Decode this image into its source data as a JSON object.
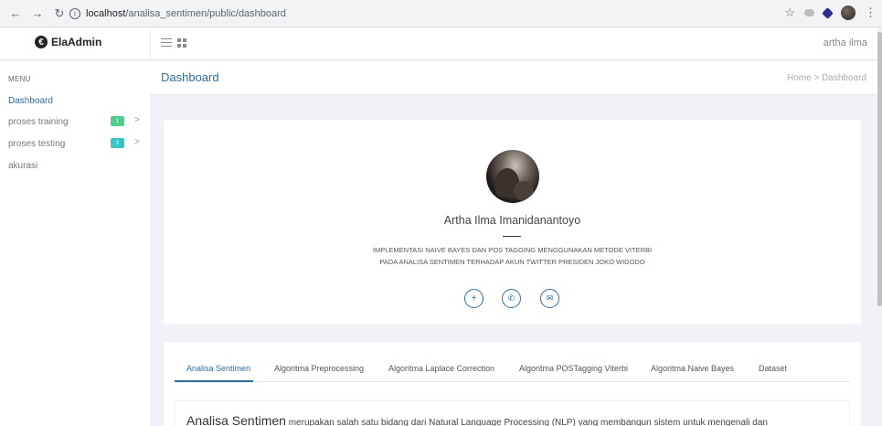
{
  "browser": {
    "url_host": "localhost",
    "url_path": "/analisa_sentimen/public/dashboard"
  },
  "header": {
    "logo_text": "ElaAdmin",
    "user_name": "artha ilma"
  },
  "sidebar": {
    "menu_title": "MENU",
    "items": [
      {
        "label": "Dashboard",
        "active": true
      },
      {
        "label": "proses training",
        "badge": "1"
      },
      {
        "label": "proses testing",
        "badge": "2"
      },
      {
        "label": "akurasi"
      }
    ]
  },
  "page": {
    "title": "Dashboard",
    "breadcrumb": "Home  >  Dashboard"
  },
  "profile": {
    "name": "Artha Ilma Imanidanantoyo",
    "desc_line1": "IMPLEMENTASI NAIVE BAYES DAN POS TAGGING MENGGUNAKAN METODE VITERBI",
    "desc_line2": "PADA ANALISA SENTIMEN TERHADAP AKUN TWITTER PRESIDEN JOKO WIDODO",
    "social_icons": [
      "plus-icon",
      "whatsapp-icon",
      "mail-icon"
    ]
  },
  "tabs": [
    "Analisa Sentimen",
    "Algoritma Preprocessing",
    "Algoritma Laplace Correction",
    "Algoritma POSTagging Viterbi",
    "Algoritma Naive Bayes",
    "Dataset"
  ],
  "content": {
    "lead": "Analisa Sentimen",
    "rest": " merupakan salah satu bidang dari Natural Language Processing (NLP) yang membangun sistem untuk mengenali dan"
  },
  "colors": {
    "accent": "#2e6da4",
    "badge_green": "#4ccf8a",
    "badge_teal": "#34c5c5",
    "background": "#f1f2f7"
  }
}
